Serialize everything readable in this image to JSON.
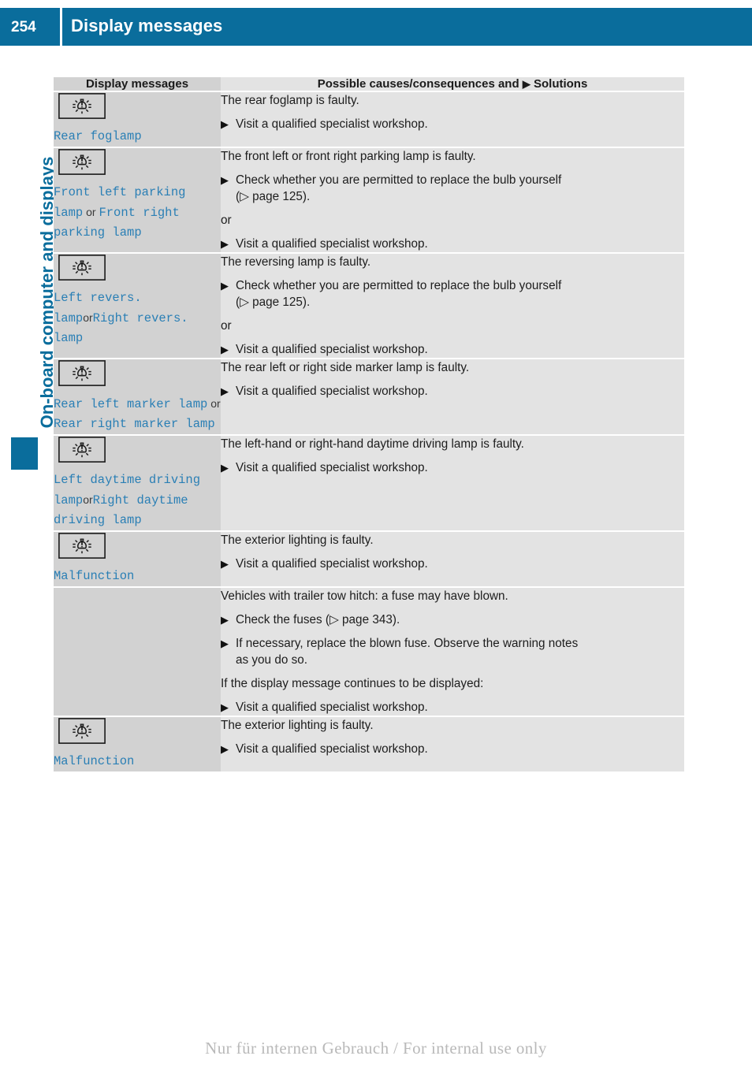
{
  "header": {
    "page_number": "254",
    "title": "Display messages"
  },
  "sidebar": {
    "chapter_label": "On-board computer and displays"
  },
  "table": {
    "columns": {
      "left_header": "Display messages",
      "right_header_prefix": "Possible causes/consequences and",
      "right_header_marker": "▶",
      "right_header_suffix": "Solutions"
    },
    "rows": [
      {
        "icon": "lamp-fault-icon",
        "code_parts": [
          {
            "text": "Rear foglamp",
            "style": "code"
          }
        ],
        "content": [
          {
            "type": "text",
            "text": "The rear foglamp is faulty."
          },
          {
            "type": "step",
            "text": "Visit a qualified specialist workshop."
          }
        ]
      },
      {
        "icon": "lamp-fault-icon",
        "code_parts": [
          {
            "text": "Front left parking lamp",
            "style": "code"
          },
          {
            "text": " or ",
            "style": "or"
          },
          {
            "text": "Front right parking lamp",
            "style": "code"
          }
        ],
        "content": [
          {
            "type": "text",
            "text": "The front left or front right parking lamp is faulty."
          },
          {
            "type": "step",
            "text": "Check whether you are permitted to replace the bulb yourself",
            "sub": "(▷ page 125)."
          },
          {
            "type": "plain",
            "text": "or"
          },
          {
            "type": "step",
            "text": "Visit a qualified specialist workshop."
          }
        ]
      },
      {
        "icon": "lamp-fault-icon",
        "code_parts": [
          {
            "text": "Left revers. lamp",
            "style": "code"
          },
          {
            "text": "or",
            "style": "or"
          },
          {
            "text": "Right revers. lamp",
            "style": "code"
          }
        ],
        "content": [
          {
            "type": "text",
            "text": "The reversing lamp is faulty."
          },
          {
            "type": "step",
            "text": "Check whether you are permitted to replace the bulb yourself",
            "sub": "(▷ page 125)."
          },
          {
            "type": "plain",
            "text": "or"
          },
          {
            "type": "step",
            "text": "Visit a qualified specialist workshop."
          }
        ]
      },
      {
        "icon": "lamp-fault-icon",
        "code_parts": [
          {
            "text": "Rear left marker lamp",
            "style": "code"
          },
          {
            "text": " or ",
            "style": "or"
          },
          {
            "text": "Rear right marker lamp",
            "style": "code"
          }
        ],
        "content": [
          {
            "type": "text",
            "text": "The rear left or right side marker lamp is faulty."
          },
          {
            "type": "step",
            "text": "Visit a qualified specialist workshop."
          }
        ]
      },
      {
        "icon": "lamp-fault-icon",
        "code_parts": [
          {
            "text": "Left daytime driving lamp",
            "style": "code"
          },
          {
            "text": "or",
            "style": "or"
          },
          {
            "text": "Right daytime driving lamp",
            "style": "code"
          }
        ],
        "content": [
          {
            "type": "text",
            "text": "The left-hand or right-hand daytime driving lamp is faulty."
          },
          {
            "type": "step",
            "text": "Visit a qualified specialist workshop."
          }
        ]
      },
      {
        "icon": "lamp-fault-icon",
        "code_parts": [
          {
            "text": "Malfunction",
            "style": "code"
          }
        ],
        "content": [
          {
            "type": "text",
            "text": "The exterior lighting is faulty."
          },
          {
            "type": "step",
            "text": "Visit a qualified specialist workshop."
          }
        ]
      },
      {
        "icon": "",
        "code_parts": [],
        "content": [
          {
            "type": "text",
            "text": "Vehicles with trailer tow hitch: a fuse may have blown."
          },
          {
            "type": "step",
            "text": "Check the fuses (▷ page 343)."
          },
          {
            "type": "step",
            "text": "If necessary, replace the blown fuse. Observe the warning notes",
            "sub": "as you do so."
          },
          {
            "type": "plain",
            "text": "If the display message continues to be displayed:"
          },
          {
            "type": "step",
            "text": "Visit a qualified specialist workshop."
          }
        ]
      },
      {
        "icon": "lamp-fault-icon",
        "code_parts": [
          {
            "text": "Malfunction",
            "style": "code"
          }
        ],
        "content": [
          {
            "type": "text",
            "text": "The exterior lighting is faulty."
          },
          {
            "type": "step",
            "text": "Visit a qualified specialist workshop."
          }
        ]
      }
    ]
  },
  "footer": {
    "watermark": "Nur für internen Gebrauch / For internal use only"
  },
  "colors": {
    "header_blue": "#0a6d9c",
    "code_blue": "#2a7fb5",
    "left_cell_gray": "#d2d2d2",
    "right_cell_gray": "#e3e3e3"
  }
}
